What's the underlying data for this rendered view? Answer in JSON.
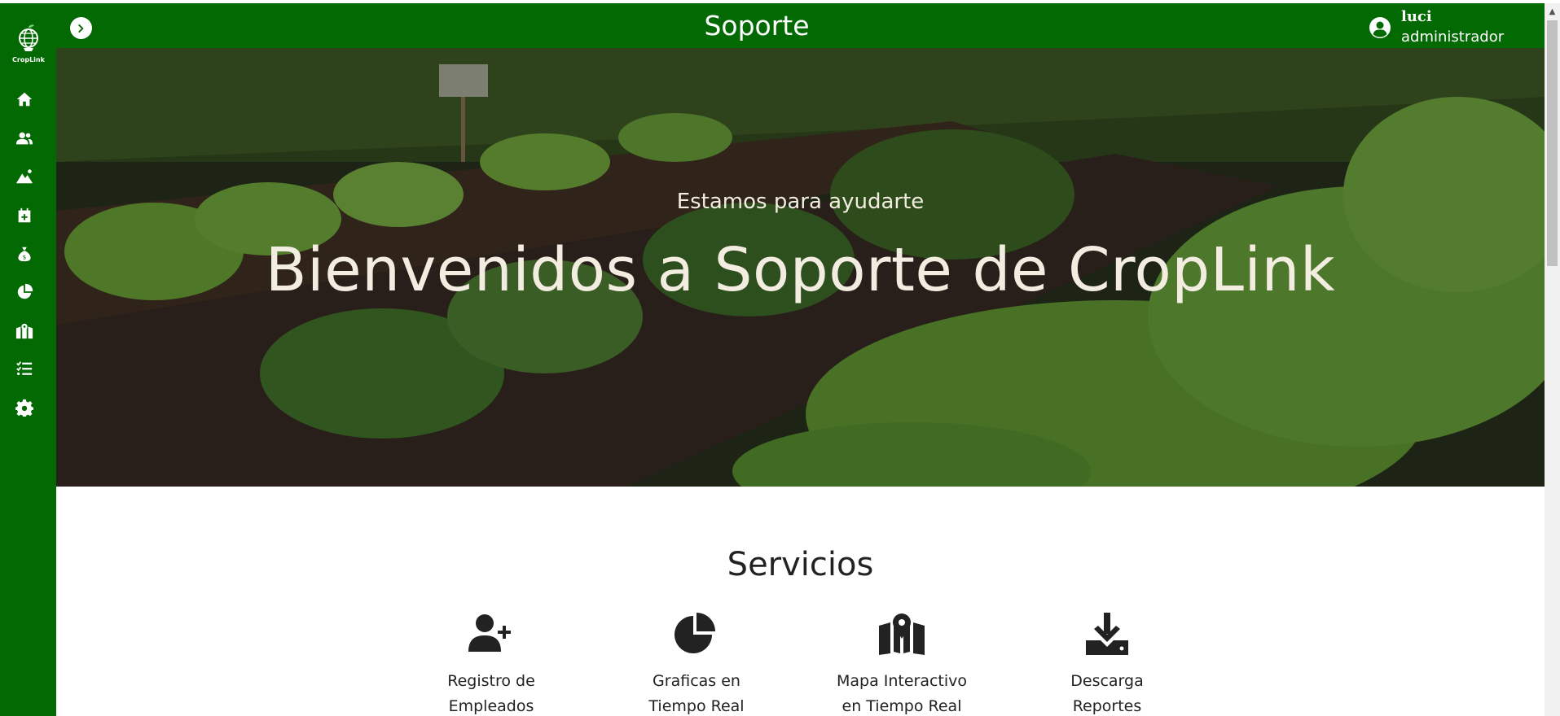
{
  "app": {
    "logo_text": "CropLink",
    "brand_color": "#036a03"
  },
  "header": {
    "title": "Soporte",
    "user_name": "luci",
    "user_role": "administrador"
  },
  "sidebar": {
    "items": [
      {
        "icon": "home-icon"
      },
      {
        "icon": "users-icon"
      },
      {
        "icon": "mountain-icon"
      },
      {
        "icon": "calendar-plus-icon"
      },
      {
        "icon": "money-bag-icon"
      },
      {
        "icon": "pie-chart-icon"
      },
      {
        "icon": "map-location-icon"
      },
      {
        "icon": "list-check-icon"
      },
      {
        "icon": "gear-icon"
      }
    ]
  },
  "hero": {
    "subtitle": "Estamos para ayudarte",
    "title": "Bienvenidos a Soporte de CropLink"
  },
  "services": {
    "heading": "Servicios",
    "items": [
      {
        "icon": "user-plus-icon",
        "line1": "Registro de",
        "line2": "Empleados"
      },
      {
        "icon": "pie-chart-icon",
        "line1": "Graficas en",
        "line2": "Tiempo Real"
      },
      {
        "icon": "map-location-icon",
        "line1": "Mapa Interactivo",
        "line2": "en Tiempo Real"
      },
      {
        "icon": "download-icon",
        "line1": "Descarga",
        "line2": "Reportes"
      }
    ]
  }
}
